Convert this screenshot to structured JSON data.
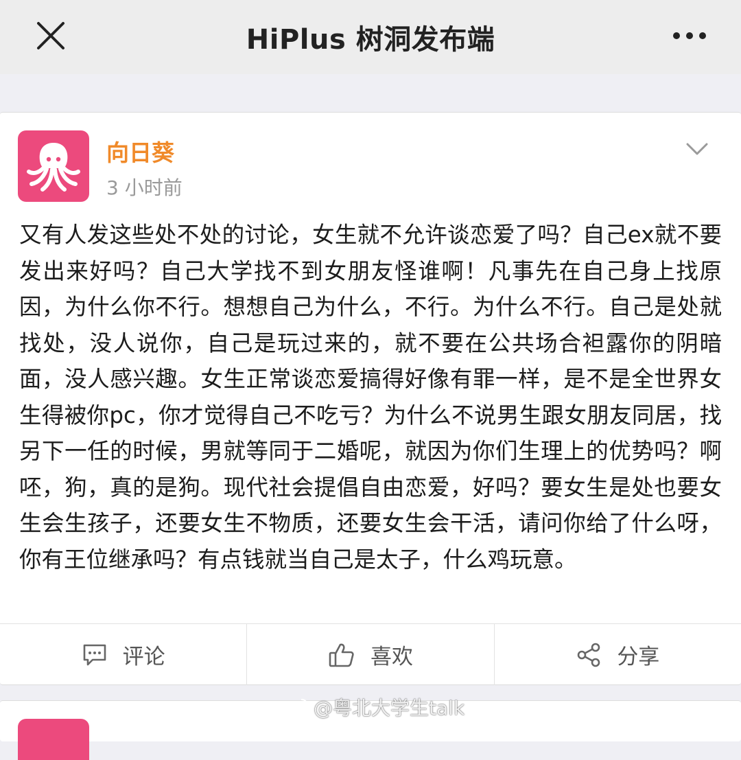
{
  "header": {
    "title": "HiPlus 树洞发布端"
  },
  "post": {
    "author": "向日葵",
    "time": "3 小时前",
    "content": "又有人发这些处不处的讨论，女生就不允许谈恋爱了吗？自己ex就不要发出来好吗？自己大学找不到女朋友怪谁啊！凡事先在自己身上找原因，为什么你不行。想想自己为什么，不行。为什么不行。自己是处就找处，没人说你，自己是玩过来的，就不要在公共场合袒露你的阴暗面，没人感兴趣。女生正常谈恋爱搞得好像有罪一样，是不是全世界女生得被你pc，你才觉得自己不吃亏？为什么不说男生跟女朋友同居，找另下一任的时候，男就等同于二婚呢，就因为你们生理上的优势吗？啊呸，狗，真的是狗。现代社会提倡自由恋爱，好吗？要女生是处也要女生会生孩子，还要女生不物质，还要女生会干活，请问你给了什么呀，你有王位继承吗？有点钱就当自己是太子，什么鸡玩意。"
  },
  "actions": {
    "comment": "评论",
    "like": "喜欢",
    "share": "分享"
  },
  "watermark": {
    "text": "@粤北大学生talk"
  },
  "colors": {
    "avatar_bg": "#ec4a7d",
    "author_name": "#f08a2a",
    "topbar_bg": "#ededed",
    "page_bg": "#efeff4"
  },
  "icons": {
    "close": "close-icon",
    "more": "more-dots-icon",
    "expand": "chevron-down-icon",
    "avatar": "octopus-icon",
    "comment": "comment-bubble-icon",
    "like": "thumbs-up-icon",
    "share": "share-icon",
    "watermark": "weibo-icon"
  }
}
